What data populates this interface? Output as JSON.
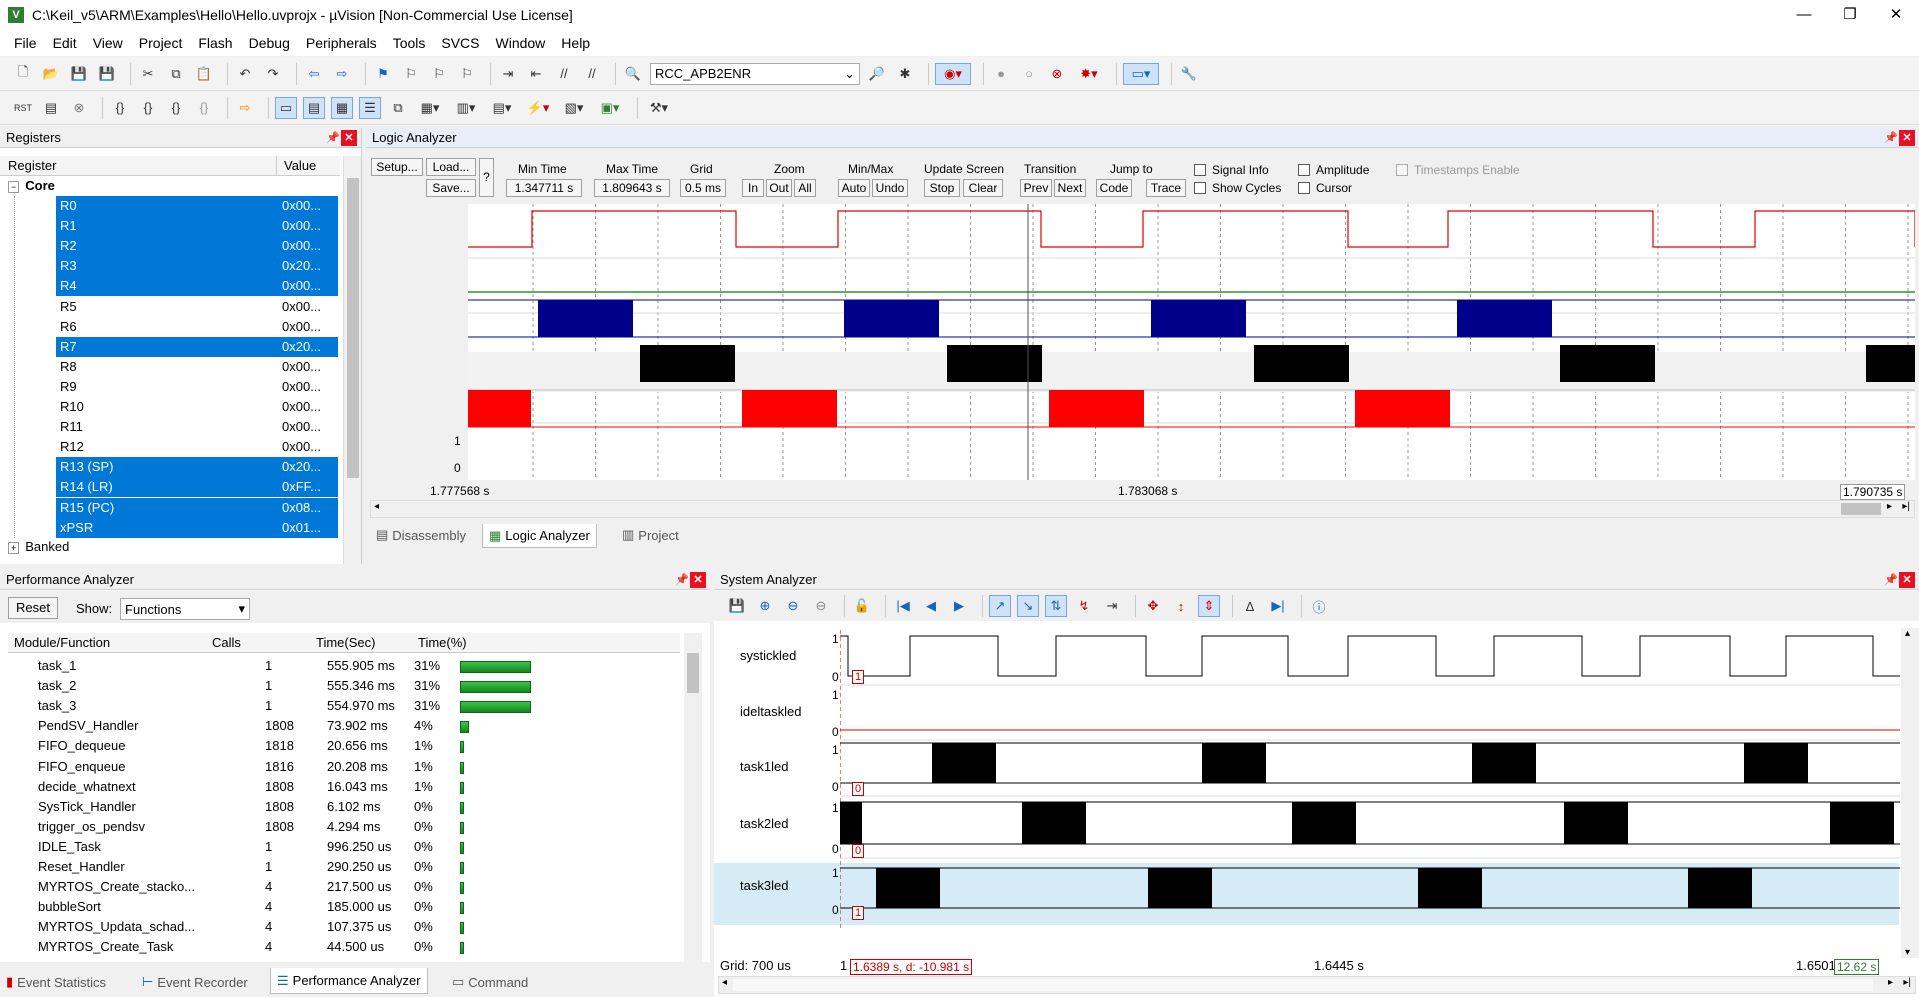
{
  "window": {
    "title": "C:\\Keil_v5\\ARM\\Examples\\Hello\\Hello.uvprojx - µVision  [Non-Commercial Use License]",
    "minimize": "—",
    "maximize": "❐",
    "close": "✕"
  },
  "menu": [
    "File",
    "Edit",
    "View",
    "Project",
    "Flash",
    "Debug",
    "Peripherals",
    "Tools",
    "SVCS",
    "Window",
    "Help"
  ],
  "toolbar": {
    "register_combo": "RCC_APB2ENR"
  },
  "registers": {
    "title": "Registers",
    "col_register": "Register",
    "col_value": "Value",
    "group": "Core",
    "banked": "Banked",
    "rows": [
      {
        "name": "R0",
        "value": "0x00...",
        "sel": true
      },
      {
        "name": "R1",
        "value": "0x00...",
        "sel": true
      },
      {
        "name": "R2",
        "value": "0x00...",
        "sel": true
      },
      {
        "name": "R3",
        "value": "0x20...",
        "sel": true
      },
      {
        "name": "R4",
        "value": "0x00...",
        "sel": true
      },
      {
        "name": "R5",
        "value": "0x00...",
        "sel": false
      },
      {
        "name": "R6",
        "value": "0x00...",
        "sel": false
      },
      {
        "name": "R7",
        "value": "0x20...",
        "sel": true
      },
      {
        "name": "R8",
        "value": "0x00...",
        "sel": false
      },
      {
        "name": "R9",
        "value": "0x00...",
        "sel": false
      },
      {
        "name": "R10",
        "value": "0x00...",
        "sel": false
      },
      {
        "name": "R11",
        "value": "0x00...",
        "sel": false
      },
      {
        "name": "R12",
        "value": "0x00...",
        "sel": false
      },
      {
        "name": "R13 (SP)",
        "value": "0x20...",
        "sel": true
      },
      {
        "name": "R14 (LR)",
        "value": "0xFF...",
        "sel": true
      },
      {
        "name": "R15 (PC)",
        "value": "0x08...",
        "sel": true
      },
      {
        "name": "xPSR",
        "value": "0x01...",
        "sel": true
      }
    ]
  },
  "logic": {
    "title": "Logic Analyzer",
    "setup": "Setup...",
    "load": "Load...",
    "save": "Save...",
    "help": "?",
    "min_time_label": "Min Time",
    "min_time": "1.347711 s",
    "max_time_label": "Max Time",
    "max_time": "1.809643 s",
    "grid_label": "Grid",
    "grid": "0.5 ms",
    "zoom_label": "Zoom",
    "zoom_in": "In",
    "zoom_out": "Out",
    "zoom_all": "All",
    "minmax_label": "Min/Max",
    "auto": "Auto",
    "undo": "Undo",
    "update_label": "Update Screen",
    "stop": "Stop",
    "clear": "Clear",
    "transition_label": "Transition",
    "prev": "Prev",
    "next": "Next",
    "jump_label": "Jump to",
    "code": "Code",
    "trace": "Trace",
    "signal_info": "Signal Info",
    "show_cycles": "Show Cycles",
    "amplitude": "Amplitude",
    "cursor": "Cursor",
    "timestamps": "Timestamps Enable",
    "signals": [
      "systickled",
      "ideltaskled",
      "task1led",
      "task2led",
      "task3led"
    ],
    "axis_one": "1",
    "axis_zero": "0",
    "t_left": "1.777568 s",
    "t_mid": "1.783068 s",
    "t_right": "1.790735 s"
  },
  "center_tabs": {
    "disassembly": "Disassembly",
    "logic": "Logic Analyzer",
    "project": "Project"
  },
  "perf": {
    "title": "Performance Analyzer",
    "reset": "Reset",
    "show_label": "Show:",
    "show_value": "Functions",
    "cols": [
      "Module/Function",
      "Calls",
      "Time(Sec)",
      "Time(%)"
    ],
    "rows": [
      {
        "name": "task_1",
        "calls": "1",
        "time": "555.905 ms",
        "pct": "31%",
        "frac": 0.31
      },
      {
        "name": "task_2",
        "calls": "1",
        "time": "555.346 ms",
        "pct": "31%",
        "frac": 0.31
      },
      {
        "name": "task_3",
        "calls": "1",
        "time": "554.970 ms",
        "pct": "31%",
        "frac": 0.31
      },
      {
        "name": "PendSV_Handler",
        "calls": "1808",
        "time": "73.902 ms",
        "pct": "4%",
        "frac": 0.04
      },
      {
        "name": "FIFO_dequeue",
        "calls": "1818",
        "time": "20.656 ms",
        "pct": "1%",
        "frac": 0.01
      },
      {
        "name": "FIFO_enqueue",
        "calls": "1816",
        "time": "20.208 ms",
        "pct": "1%",
        "frac": 0.01
      },
      {
        "name": "decide_whatnext",
        "calls": "1808",
        "time": "16.043 ms",
        "pct": "1%",
        "frac": 0.01
      },
      {
        "name": "SysTick_Handler",
        "calls": "1808",
        "time": "6.102 ms",
        "pct": "0%",
        "frac": 0.003
      },
      {
        "name": "trigger_os_pendsv",
        "calls": "1808",
        "time": "4.294 ms",
        "pct": "0%",
        "frac": 0.002
      },
      {
        "name": "IDLE_Task",
        "calls": "1",
        "time": "996.250 us",
        "pct": "0%",
        "frac": 0.001
      },
      {
        "name": "Reset_Handler",
        "calls": "1",
        "time": "290.250 us",
        "pct": "0%",
        "frac": 0.001
      },
      {
        "name": "MYRTOS_Create_stacko...",
        "calls": "4",
        "time": "217.500 us",
        "pct": "0%",
        "frac": 0.001
      },
      {
        "name": "bubbleSort",
        "calls": "4",
        "time": "185.000 us",
        "pct": "0%",
        "frac": 0.001
      },
      {
        "name": "MYRTOS_Updata_schad...",
        "calls": "4",
        "time": "107.375 us",
        "pct": "0%",
        "frac": 0.001
      },
      {
        "name": "MYRTOS_Create_Task",
        "calls": "4",
        "time": "44.500 us",
        "pct": "0%",
        "frac": 0.001
      }
    ]
  },
  "bottom_tabs": {
    "event_stats": "Event Statistics",
    "event_recorder": "Event Recorder",
    "perf": "Performance Analyzer",
    "command": "Command"
  },
  "sysan": {
    "title": "System Analyzer",
    "signals": [
      "systickled",
      "ideltaskled",
      "task1led",
      "task2led",
      "task3led"
    ],
    "one": "1",
    "zero": "0",
    "marker": "1",
    "marker_zero": "0",
    "grid": "Grid: 700 us",
    "t_left": "1",
    "cursor_readout": "1.6389 s, d: -10.981 s",
    "t_mid": "1.6445 s",
    "t_right": "1.6501",
    "delta": "12.62 s"
  },
  "colors": {
    "selection": "#0078d7",
    "systick": "#e00000",
    "task1": "#00008b",
    "task2": "#000000",
    "task3": "#ff0000",
    "idle": "#007f00"
  }
}
